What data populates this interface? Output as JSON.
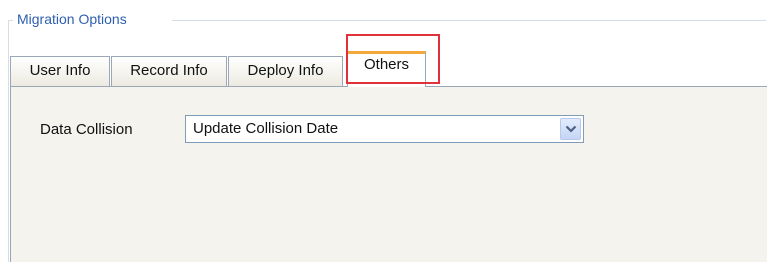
{
  "group": {
    "title": "Migration Options"
  },
  "tabs": [
    {
      "label": "User Info"
    },
    {
      "label": "Record Info"
    },
    {
      "label": "Deploy Info"
    },
    {
      "label": "Others"
    }
  ],
  "active_tab": "Others",
  "others_panel": {
    "data_collision": {
      "label": "Data Collision",
      "selected_value": "Update Collision Date",
      "icon": "chevron-down-icon"
    }
  },
  "colors": {
    "group_title": "#2d5fb0",
    "active_tab_accent": "#f2a83a",
    "highlight": "#e0313a",
    "panel_bg": "#f4f3ee"
  }
}
